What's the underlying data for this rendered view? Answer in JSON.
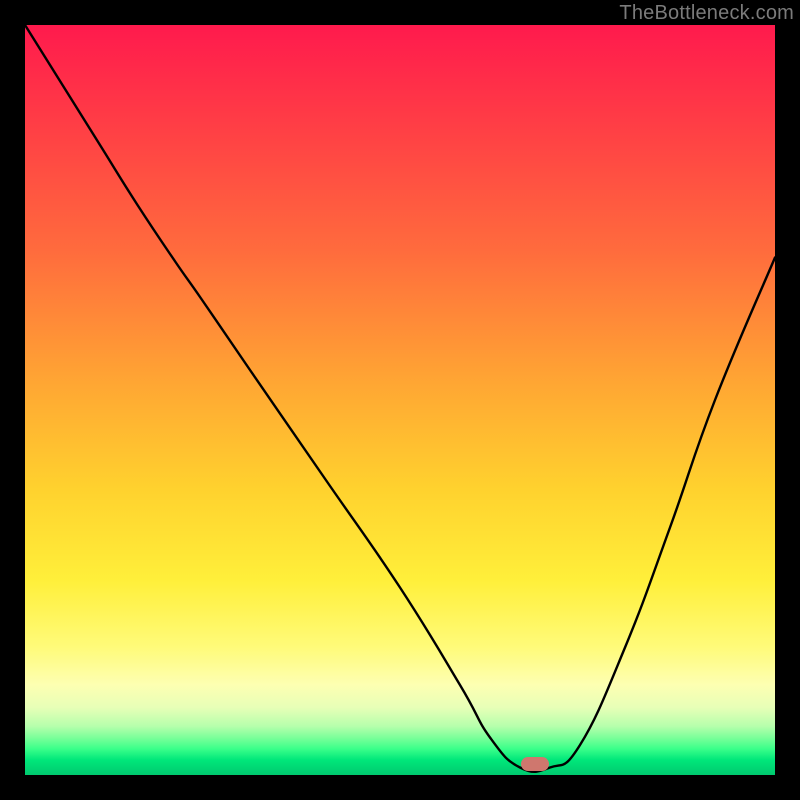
{
  "watermark": "TheBottleneck.com",
  "marker": {
    "x_frac": 0.68,
    "y_frac": 0.985,
    "color": "#cf776e"
  },
  "chart_data": {
    "type": "line",
    "title": "",
    "xlabel": "",
    "ylabel": "",
    "xlim": [
      0,
      1
    ],
    "ylim": [
      0,
      1
    ],
    "series": [
      {
        "name": "curve",
        "x": [
          0.0,
          0.05,
          0.1,
          0.15,
          0.2,
          0.235,
          0.3,
          0.4,
          0.5,
          0.58,
          0.62,
          0.66,
          0.7,
          0.74,
          0.8,
          0.86,
          0.92,
          1.0
        ],
        "y": [
          1.0,
          0.92,
          0.84,
          0.76,
          0.685,
          0.635,
          0.54,
          0.395,
          0.25,
          0.12,
          0.05,
          0.01,
          0.01,
          0.04,
          0.17,
          0.33,
          0.5,
          0.69
        ]
      }
    ],
    "annotations": [
      {
        "type": "marker",
        "x": 0.68,
        "y": 0.015,
        "shape": "pill",
        "color": "#cf776e"
      }
    ]
  }
}
